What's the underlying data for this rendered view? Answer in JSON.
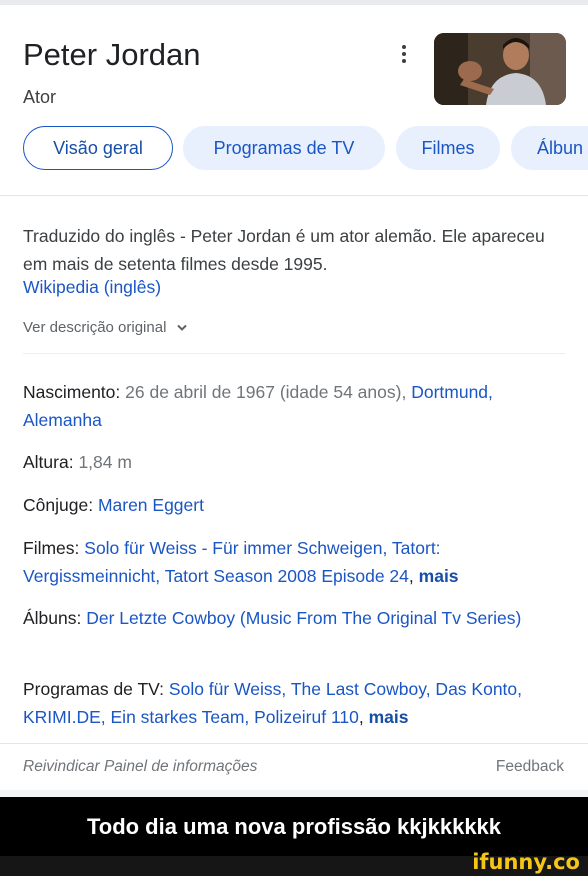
{
  "panel": {
    "title": "Peter Jordan",
    "subtitle": "Ator",
    "more_icon": "kebab-menu-icon",
    "avatar_icon": "person-photo"
  },
  "tabs": [
    {
      "label": "Visão geral",
      "active": true
    },
    {
      "label": "Programas de TV"
    },
    {
      "label": "Filmes"
    },
    {
      "label": "Álbun"
    }
  ],
  "description": {
    "text": "Traduzido do inglês - Peter Jordan é um ator alemão. Ele apareceu em mais de setenta filmes desde 1995.",
    "source_link": "Wikipedia (inglês)",
    "original_toggle": "Ver descrição original",
    "toggle_icon": "chevron-down-icon"
  },
  "facts": {
    "birth": {
      "label": "Nascimento:",
      "value": "26 de abril de 1967 (idade 54 anos),",
      "link": "Dortmund, Alemanha"
    },
    "height": {
      "label": "Altura:",
      "value": "1,84 m"
    },
    "spouse": {
      "label": "Cônjuge:",
      "link": "Maren Eggert"
    },
    "films": {
      "label": "Filmes:",
      "link": "Solo für Weiss - Für immer Schweigen, Tatort: Vergissmeinnicht, Tatort Season 2008 Episode 24",
      "sep": ",",
      "more": "mais"
    },
    "albums": {
      "label": "Álbuns:",
      "link": "Der Letzte Cowboy (Music From The Original Tv Series)"
    },
    "tv": {
      "label": "Programas de TV:",
      "link": "Solo für Weiss, The Last Cowboy, Das Konto, KRIMI.DE, Ein starkes Team, Polizeiruf 110",
      "sep": ",",
      "more": "mais"
    }
  },
  "footer": {
    "claim": "Reivindicar Painel de informações",
    "feedback": "Feedback"
  },
  "meme": {
    "caption": "Todo dia uma nova profissão kkjkkkkkk",
    "watermark": "ifunny.co"
  },
  "colors": {
    "link": "#1a56c4",
    "chip_bg": "#e8f0fe",
    "meme_bar": "#000000",
    "watermark": "#f5c518"
  }
}
